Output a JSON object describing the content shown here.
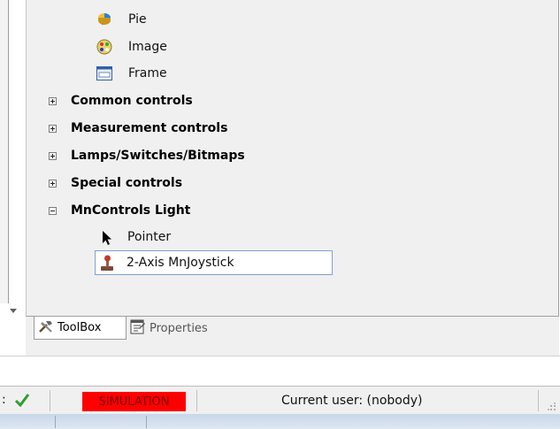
{
  "toolbox": {
    "items_top": [
      {
        "label": "Pie",
        "icon": "pie-chart-icon"
      },
      {
        "label": "Image",
        "icon": "image-icon"
      },
      {
        "label": "Frame",
        "icon": "frame-icon"
      }
    ],
    "groups": [
      {
        "label": "Common controls",
        "expanded": false
      },
      {
        "label": "Measurement controls",
        "expanded": false
      },
      {
        "label": "Lamps/Switches/Bitmaps",
        "expanded": false
      },
      {
        "label": "Special controls",
        "expanded": false
      },
      {
        "label": "MnControls Light",
        "expanded": true
      }
    ],
    "mncontrols_items": [
      {
        "label": "Pointer",
        "icon": "pointer-arrow-icon"
      },
      {
        "label": "2-Axis MnJoystick",
        "icon": "joystick-icon",
        "selected": true
      }
    ]
  },
  "tabs": [
    {
      "label": "ToolBox",
      "icon": "tools-icon",
      "active": true
    },
    {
      "label": "Properties",
      "icon": "properties-icon",
      "active": false
    }
  ],
  "statusbar": {
    "prefix": ":",
    "status_icon": "check-icon",
    "mode": "SIMULATION",
    "user_text": "Current user: (nobody)"
  },
  "colors": {
    "simulation_bg": "#ff0000",
    "check": "#2e9e2e",
    "selection_border": "#7da2ce"
  }
}
